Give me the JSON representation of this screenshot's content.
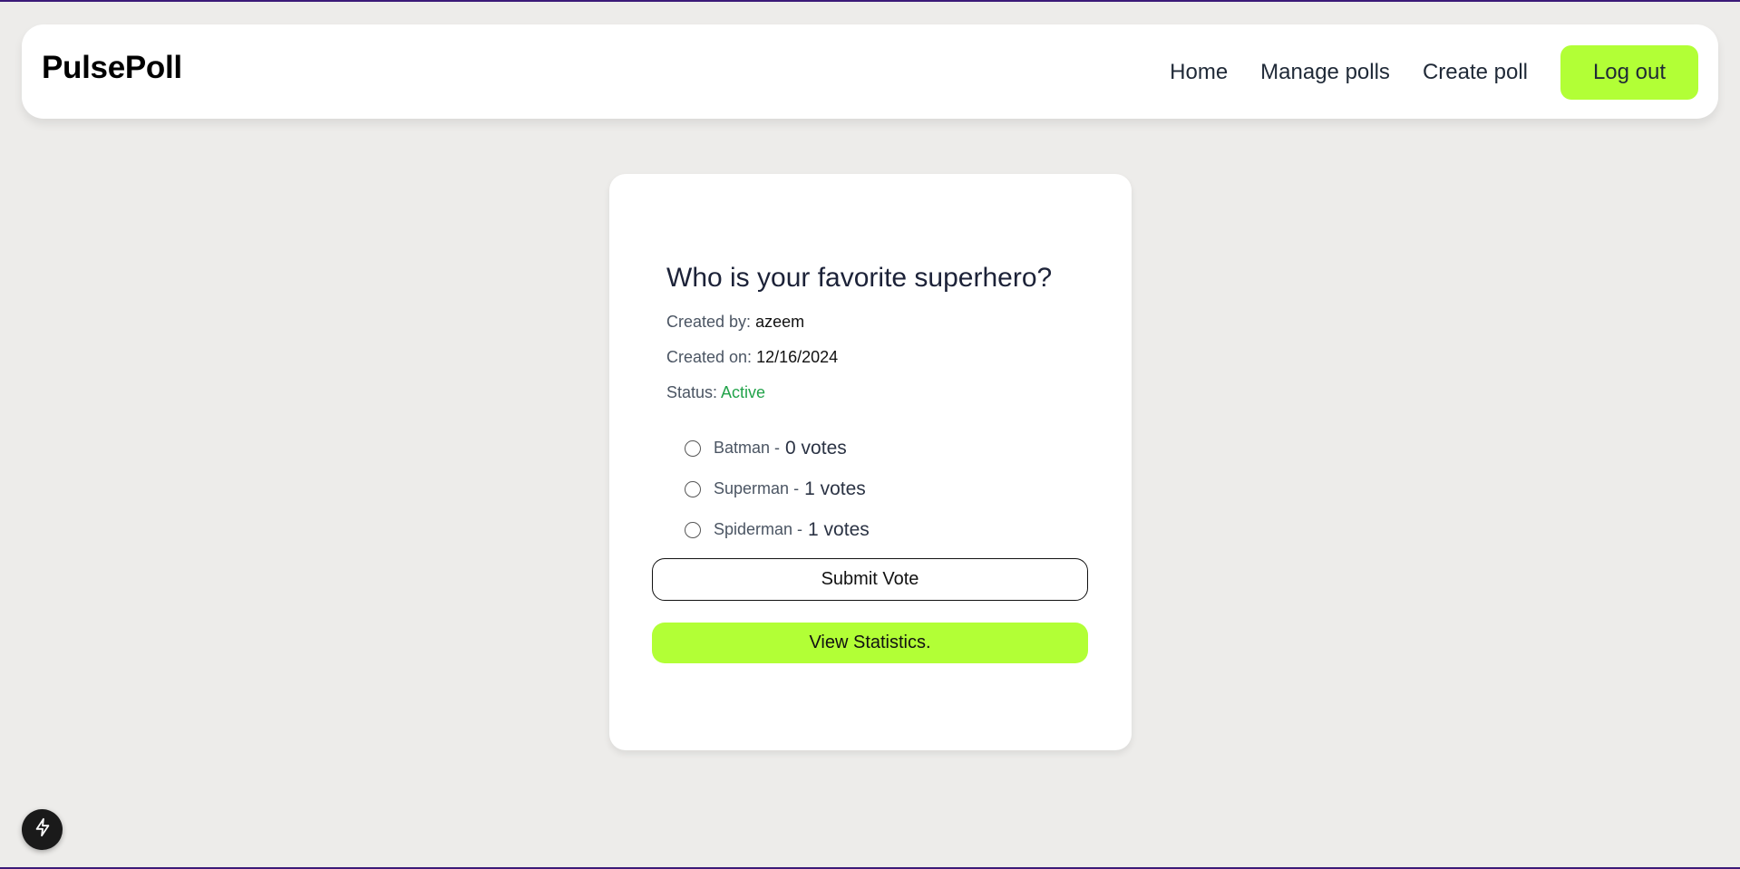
{
  "header": {
    "brand": "PulsePoll",
    "nav": [
      {
        "label": "Home"
      },
      {
        "label": "Manage polls"
      },
      {
        "label": "Create poll"
      }
    ],
    "logout_label": "Log out"
  },
  "poll": {
    "question": "Who is your favorite superhero?",
    "created_by_label": "Created by:",
    "created_by": "azeem",
    "created_on_label": "Created on:",
    "created_on": "12/16/2024",
    "status_label": "Status:",
    "status": "Active",
    "options": [
      {
        "label": "Batman",
        "sep": "-",
        "votes": "0 votes"
      },
      {
        "label": "Superman",
        "sep": "-",
        "votes": "1 votes"
      },
      {
        "label": "Spiderman",
        "sep": "-",
        "votes": "1 votes"
      }
    ],
    "submit_label": "Submit Vote",
    "stats_label": "View Statistics."
  },
  "colors": {
    "accent": "#b2ff36",
    "status_active": "#22a34a",
    "background": "#edecea"
  },
  "fab": {
    "icon": "lightning-icon"
  }
}
